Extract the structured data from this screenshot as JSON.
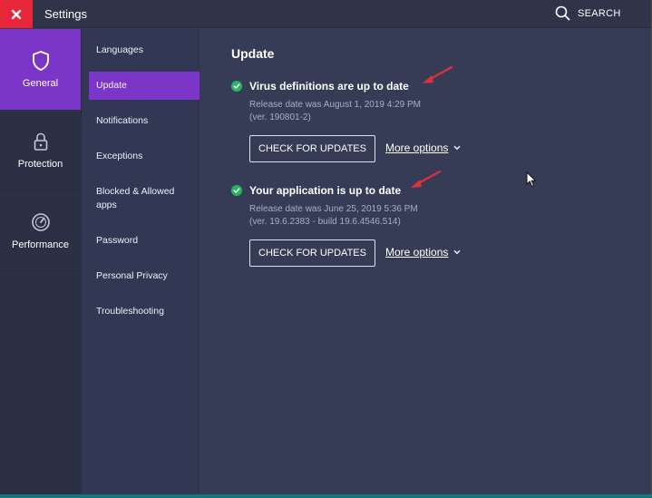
{
  "titlebar": {
    "title": "Settings",
    "search_label": "SEARCH"
  },
  "rail": {
    "items": [
      {
        "label": "General",
        "icon": "shield-icon",
        "active": true
      },
      {
        "label": "Protection",
        "icon": "lock-icon",
        "active": false
      },
      {
        "label": "Performance",
        "icon": "speedometer-icon",
        "active": false
      }
    ]
  },
  "submenu": {
    "items": [
      {
        "label": "Languages"
      },
      {
        "label": "Update",
        "active": true
      },
      {
        "label": "Notifications"
      },
      {
        "label": "Exceptions"
      },
      {
        "label": "Blocked & Allowed apps"
      },
      {
        "label": "Password"
      },
      {
        "label": "Personal Privacy"
      },
      {
        "label": "Troubleshooting"
      }
    ]
  },
  "main": {
    "title": "Update",
    "sections": [
      {
        "status": "Virus definitions are up to date",
        "release_line": "Release date was August 1, 2019 4:29 PM",
        "version_line": "(ver. 190801-2)",
        "button": "CHECK FOR UPDATES",
        "more": "More options"
      },
      {
        "status": "Your application is up to date",
        "release_line": "Release date was June 25, 2019 5:36 PM",
        "version_line": "(ver. 19.6.2383 - build 19.6.4546.514)",
        "button": "CHECK FOR UPDATES",
        "more": "More options"
      }
    ]
  },
  "colors": {
    "accent_purple": "#7b35c9",
    "close_red": "#e8263a",
    "status_green": "#27b560",
    "annotation_arrow": "#e0303a"
  }
}
